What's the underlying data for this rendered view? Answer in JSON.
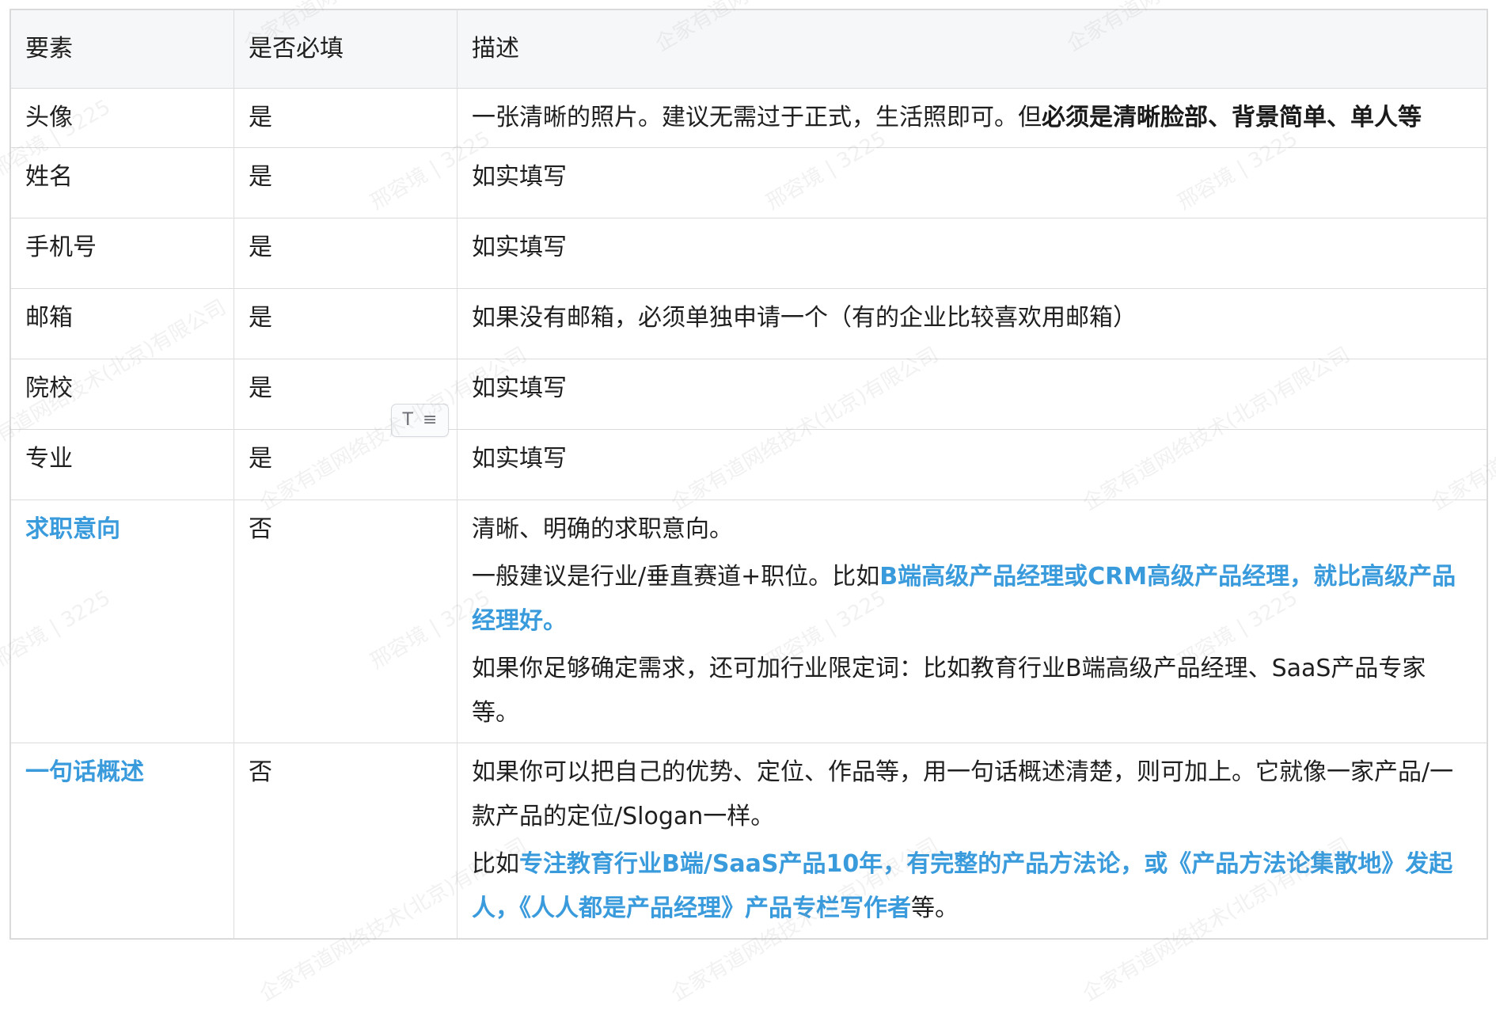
{
  "table": {
    "headers": [
      "要素",
      "是否必填",
      "描述"
    ],
    "rows": [
      {
        "element": "头像",
        "required": "是",
        "desc": [
          [
            {
              "text": "一张清晰的照片。建议无需过于正式，生活照即可。但"
            },
            {
              "text": "必须是清晰脸部、背景简单、单人等",
              "style": "bold"
            }
          ]
        ]
      },
      {
        "element": "姓名",
        "required": "是",
        "desc": [
          [
            {
              "text": "如实填写"
            }
          ]
        ]
      },
      {
        "element": "手机号",
        "required": "是",
        "desc": [
          [
            {
              "text": "如实填写"
            }
          ]
        ]
      },
      {
        "element": "邮箱",
        "required": "是",
        "desc": [
          [
            {
              "text": "如果没有邮箱，必须单独申请一个（有的企业比较喜欢用邮箱）"
            }
          ]
        ]
      },
      {
        "element": "院校",
        "required": "是",
        "desc": [
          [
            {
              "text": "如实填写"
            }
          ]
        ]
      },
      {
        "element": "专业",
        "required": "是",
        "desc": [
          [
            {
              "text": "如实填写"
            }
          ]
        ]
      },
      {
        "element": "求职意向",
        "element_style": "blue",
        "required": "否",
        "desc": [
          [
            {
              "text": "清晰、明确的求职意向。"
            }
          ],
          [
            {
              "text": "一般建议是行业/垂直赛道+职位。比如"
            },
            {
              "text": "B端高级产品经理或CRM高级产品经理，就比高级产品经理好。",
              "style": "blue"
            }
          ],
          [
            {
              "text": "如果你足够确定需求，还可加行业限定词：比如教育行业B端高级产品经理、SaaS产品专家等。"
            }
          ]
        ]
      },
      {
        "element": "一句话概述",
        "element_style": "blue",
        "required": "否",
        "desc": [
          [
            {
              "text": "如果你可以把自己的优势、定位、作品等，用一句话概述清楚，则可加上。它就像一家产品/一款产品的定位/Slogan一样。"
            }
          ],
          [
            {
              "text": "比如"
            },
            {
              "text": "专注教育行业B端/SaaS产品10年，有完整的产品方法论，或《产品方法论集散地》发起人，《人人都是产品经理》产品专栏写作者",
              "style": "blue"
            },
            {
              "text": "等。"
            }
          ]
        ]
      }
    ]
  },
  "toolbar": {
    "text_icon_glyph": "T",
    "menu_icon_glyph": "≡"
  },
  "watermark": {
    "texts": [
      "邢容境 | 3225",
      "企家有道网络技术(北京)有限公司"
    ]
  },
  "colors": {
    "accent_blue": "#3a9bdc",
    "header_bg": "#f6f7f8",
    "border": "#dcdcdc"
  }
}
